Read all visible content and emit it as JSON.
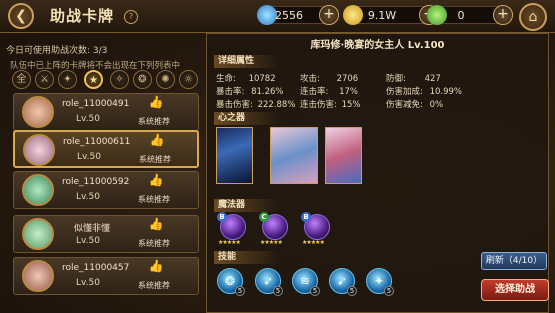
{
  "header": {
    "title": "助战卡牌",
    "help_icon": "?",
    "resources": [
      {
        "icon": "water-drop-icon",
        "value": "2556"
      },
      {
        "icon": "gold-coin-icon",
        "value": "9.1W"
      },
      {
        "icon": "green-gem-icon",
        "value": "0"
      }
    ]
  },
  "left": {
    "count_text": "今日可使用助战次数: 3/3",
    "hint": "队伍中已上阵的卡牌将不会出现在下列列表中",
    "filters": [
      "全",
      "⚔",
      "✦",
      "★",
      "✧",
      "❂",
      "✺",
      "☼"
    ],
    "cards": [
      {
        "name": "role_11000491",
        "level": "Lv.50",
        "rec": "系统推荐",
        "selected": false,
        "color": "#a86a4a"
      },
      {
        "name": "role_11000611",
        "level": "Lv.50",
        "rec": "系统推荐",
        "selected": true,
        "color": "#9a6a8a"
      },
      {
        "name": "role_11000592",
        "level": "Lv.50",
        "rec": "系统推荐",
        "selected": false,
        "color": "#3a8a5a"
      },
      {
        "name": "似懂非懂",
        "level": "Lv.50",
        "rec": "系统推荐",
        "selected": false,
        "color": "#5a9a6a"
      },
      {
        "name": "role_11000457",
        "level": "Lv.50",
        "rec": "系统推荐",
        "selected": false,
        "color": "#9a5a4a"
      }
    ]
  },
  "detail": {
    "title": "库玛修·晚宴的女主人  Lv.100",
    "section_attrs": "详细属性",
    "stats": [
      {
        "label": "生命:",
        "value": "10782"
      },
      {
        "label": "攻击:",
        "value": "2706"
      },
      {
        "label": "防御:",
        "value": "427"
      },
      {
        "label": "暴击率:",
        "value": "81.26%"
      },
      {
        "label": "连击率:",
        "value": "17%"
      },
      {
        "label": "伤害加成:",
        "value": "10.99%"
      },
      {
        "label": "暴击伤害:",
        "value": "222.88%"
      },
      {
        "label": "连击伤害:",
        "value": "15%"
      },
      {
        "label": "伤害减免:",
        "value": "0%"
      }
    ],
    "section_heart": "心之器",
    "section_magic": "魔法器",
    "magic": [
      {
        "badge": "B",
        "badge_color": "#3a6ad8",
        "stars": "★★★★★"
      },
      {
        "badge": "C",
        "badge_color": "#2a9a3a",
        "stars": "★★★★★"
      },
      {
        "badge": "B",
        "badge_color": "#3a6ad8",
        "stars": "★★★★★"
      }
    ],
    "section_skill": "技能",
    "skills": [
      {
        "icon": "❂",
        "level": "5"
      },
      {
        "icon": "➶",
        "level": "5"
      },
      {
        "icon": "≋",
        "level": "5"
      },
      {
        "icon": "➹",
        "level": "5"
      },
      {
        "icon": "✦",
        "level": "5"
      }
    ]
  },
  "buttons": {
    "refresh": "刷新（4/10）",
    "select": "选择助战"
  }
}
